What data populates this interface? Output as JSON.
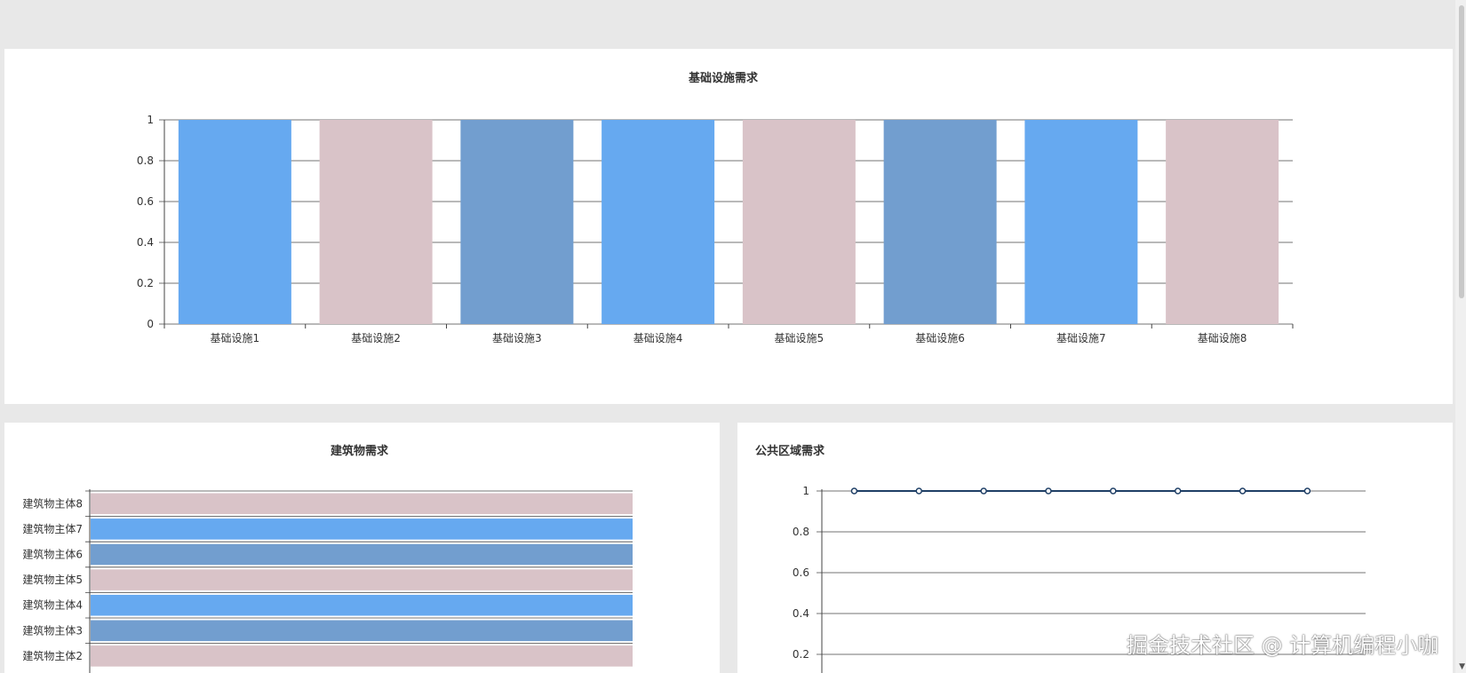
{
  "colors": {
    "blue": "#66a9f0",
    "pink": "#d9c3c8",
    "steel": "#729ecf",
    "line": "#1f3f66"
  },
  "chart_data": [
    {
      "type": "bar",
      "title": "基础设施需求",
      "categories": [
        "基础设施1",
        "基础设施2",
        "基础设施3",
        "基础设施4",
        "基础设施5",
        "基础设施6",
        "基础设施7",
        "基础设施8"
      ],
      "values": [
        1,
        1,
        1,
        1,
        1,
        1,
        1,
        1
      ],
      "ylim": [
        0,
        1
      ],
      "yticks": [
        "0",
        "0.2",
        "0.4",
        "0.6",
        "0.8",
        "1"
      ],
      "grid": true
    },
    {
      "type": "bar",
      "orientation": "horizontal",
      "title": "建筑物需求",
      "categories": [
        "建筑物主体8",
        "建筑物主体7",
        "建筑物主体6",
        "建筑物主体5",
        "建筑物主体4",
        "建筑物主体3",
        "建筑物主体2"
      ],
      "values": [
        1,
        1,
        1,
        1,
        1,
        1,
        1
      ],
      "xlim": [
        0,
        1
      ]
    },
    {
      "type": "line",
      "title": "公共区域需求",
      "values": [
        1,
        1,
        1,
        1,
        1,
        1,
        1,
        1
      ],
      "ylim": [
        0,
        1
      ],
      "yticks": [
        "0.2",
        "0.4",
        "0.6",
        "0.8",
        "1"
      ],
      "grid": true
    }
  ],
  "watermark": "掘金技术社区 @ 计算机编程小咖"
}
